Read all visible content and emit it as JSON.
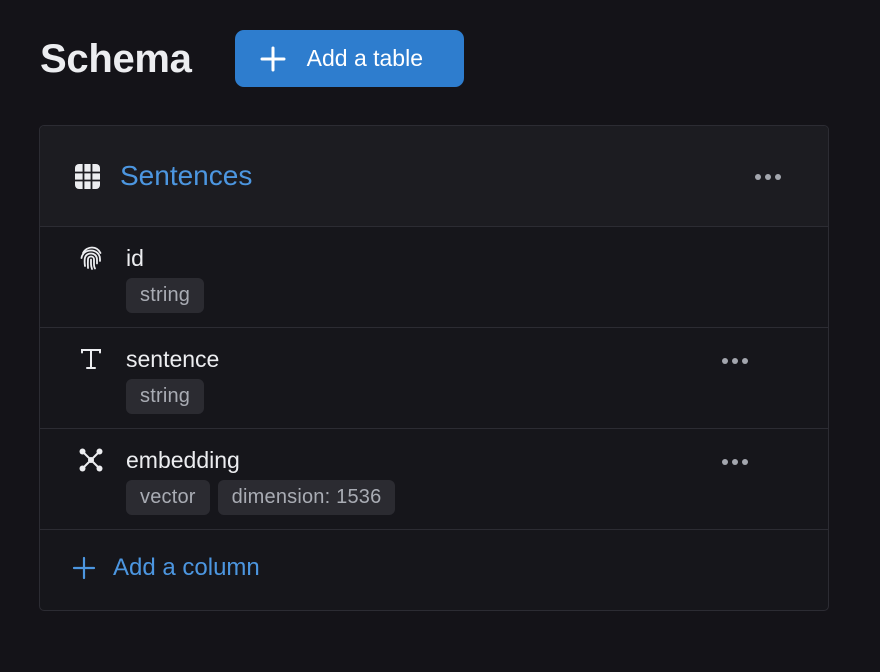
{
  "header": {
    "title": "Schema",
    "add_table_label": "Add a table",
    "add_table_icon": "plus-icon"
  },
  "table": {
    "name": "Sentences",
    "icon": "table-grid-icon",
    "columns": [
      {
        "name": "id",
        "icon": "fingerprint-icon",
        "tags": [
          "string"
        ],
        "has_menu": false
      },
      {
        "name": "sentence",
        "icon": "text-type-icon",
        "tags": [
          "string"
        ],
        "has_menu": true
      },
      {
        "name": "embedding",
        "icon": "vector-icon",
        "tags": [
          "vector",
          "dimension: 1536"
        ],
        "has_menu": true
      }
    ],
    "add_column_label": "Add a column"
  },
  "colors": {
    "background": "#141318",
    "card": "#16161B",
    "card_header": "#1C1C21",
    "border": "#2C2C33",
    "accent": "#2E7DCE",
    "link": "#4C96E0",
    "tag_bg": "#2B2B31",
    "tag_text": "#A9ACB4"
  }
}
